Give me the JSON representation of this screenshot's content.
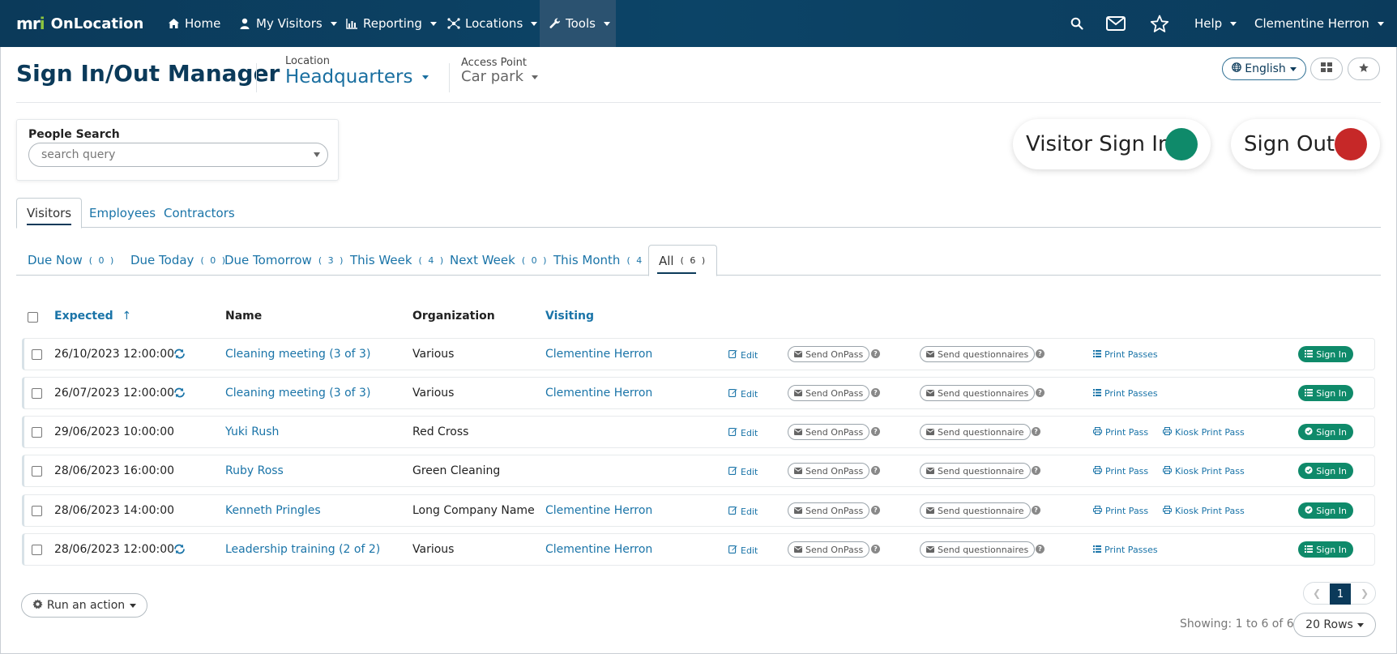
{
  "nav": {
    "brand_logo": "mri",
    "brand_name": "OnLocation",
    "items": [
      {
        "label": "Home"
      },
      {
        "label": "My Visitors"
      },
      {
        "label": "Reporting"
      },
      {
        "label": "Locations"
      },
      {
        "label": "Tools"
      }
    ],
    "help_label": "Help",
    "user_label": "Clementine Herron"
  },
  "header": {
    "title": "Sign In/Out Manager",
    "location_label": "Location",
    "location_value": "Headquarters",
    "access_point_label": "Access Point",
    "access_point_value": "Car park",
    "language_label": "English"
  },
  "search": {
    "label": "People Search",
    "placeholder": "search query"
  },
  "big_buttons": {
    "visitor_sign_in": "Visitor Sign In",
    "sign_out": "Sign Out",
    "sign_in_color": "#0f8a6a",
    "sign_out_color": "#c62828"
  },
  "tabs": [
    "Visitors",
    "Employees",
    "Contractors"
  ],
  "subtabs": [
    {
      "label": "Due Now",
      "count": "( 0 )"
    },
    {
      "label": "Due Today",
      "count": "( 0 )"
    },
    {
      "label": "Due Tomorrow",
      "count": "( 3 )"
    },
    {
      "label": "This Week",
      "count": "( 4 )"
    },
    {
      "label": "Next Week",
      "count": "( 0 )"
    },
    {
      "label": "This Month",
      "count": "( 4 )"
    },
    {
      "label": "All",
      "count": "( 6 )"
    }
  ],
  "table": {
    "headers": {
      "expected": "Expected",
      "sort_arrow": "↑",
      "name": "Name",
      "organization": "Organization",
      "visiting": "Visiting"
    },
    "labels": {
      "edit": "Edit",
      "send_onpass": "Send OnPass",
      "send_questionnaires": "Send questionnaires",
      "send_questionnaire": "Send questionnaire",
      "print_passes": "Print Passes",
      "print_pass": "Print Pass",
      "kiosk_print_pass": "Kiosk Print Pass",
      "sign_in": "Sign In"
    },
    "rows": [
      {
        "expected": "26/10/2023 12:00:00",
        "name": "Cleaning meeting (3 of 3)",
        "organization": "Various",
        "visiting": "Clementine Herron"
      },
      {
        "expected": "26/07/2023 12:00:00",
        "name": "Cleaning meeting (3 of 3)",
        "organization": "Various",
        "visiting": "Clementine Herron"
      },
      {
        "expected": "29/06/2023 10:00:00",
        "name": "Yuki Rush",
        "organization": "Red Cross",
        "visiting": ""
      },
      {
        "expected": "28/06/2023 16:00:00",
        "name": "Ruby Ross",
        "organization": "Green Cleaning",
        "visiting": ""
      },
      {
        "expected": "28/06/2023 14:00:00",
        "name": "Kenneth Pringles",
        "organization": "Long Company Name",
        "visiting": "Clementine Herron"
      },
      {
        "expected": "28/06/2023 12:00:00",
        "name": "Leadership training (2 of 2)",
        "organization": "Various",
        "visiting": "Clementine Herron"
      }
    ]
  },
  "footer": {
    "run_action": "Run an action",
    "page_current": "1",
    "showing": "Showing: 1 to 6 of 6",
    "rows_label": "20 Rows"
  }
}
